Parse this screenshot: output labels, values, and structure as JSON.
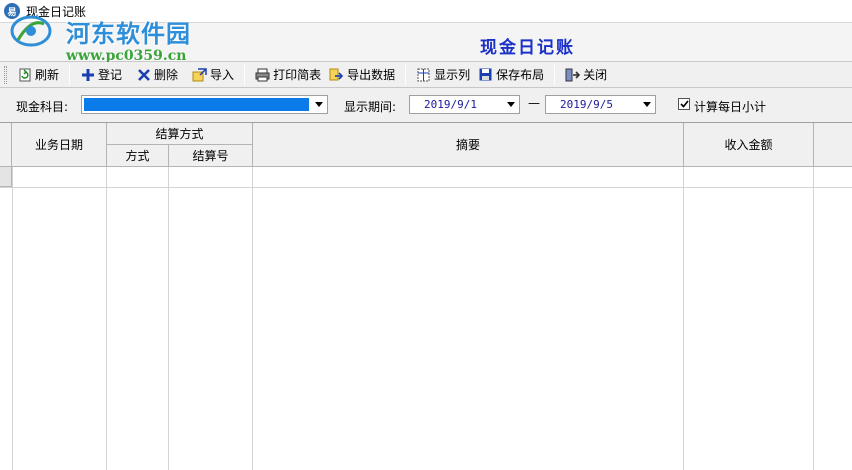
{
  "window": {
    "title": "现金日记账",
    "icon": "app-logo-icon"
  },
  "watermark": {
    "name": "河东软件园",
    "url": "www.pc0359.cn"
  },
  "banner": {
    "title": "现金日记账"
  },
  "toolbar": {
    "refresh": "刷新",
    "register": "登记",
    "delete": "删除",
    "import": "导入",
    "print": "打印简表",
    "export": "导出数据",
    "columns": "显示列",
    "save_layout": "保存布局",
    "close": "关闭"
  },
  "filter": {
    "account_label": "现金科目:",
    "account_value": "",
    "period_label": "显示期间:",
    "date_from": "2019/9/1",
    "date_separator": "—",
    "date_to": "2019/9/5",
    "daily_subtotal_label": "计算每日小计",
    "daily_subtotal_checked": true
  },
  "grid": {
    "columns": {
      "date": "业务日期",
      "settlement": "结算方式",
      "method": "方式",
      "settlement_no": "结算号",
      "summary": "摘要",
      "income": "收入金额"
    }
  },
  "colors": {
    "banner_title": "#1b2fc9",
    "selection": "#0a7be8",
    "watermark_name": "#2e8fd8",
    "watermark_url": "#3aa43a"
  }
}
